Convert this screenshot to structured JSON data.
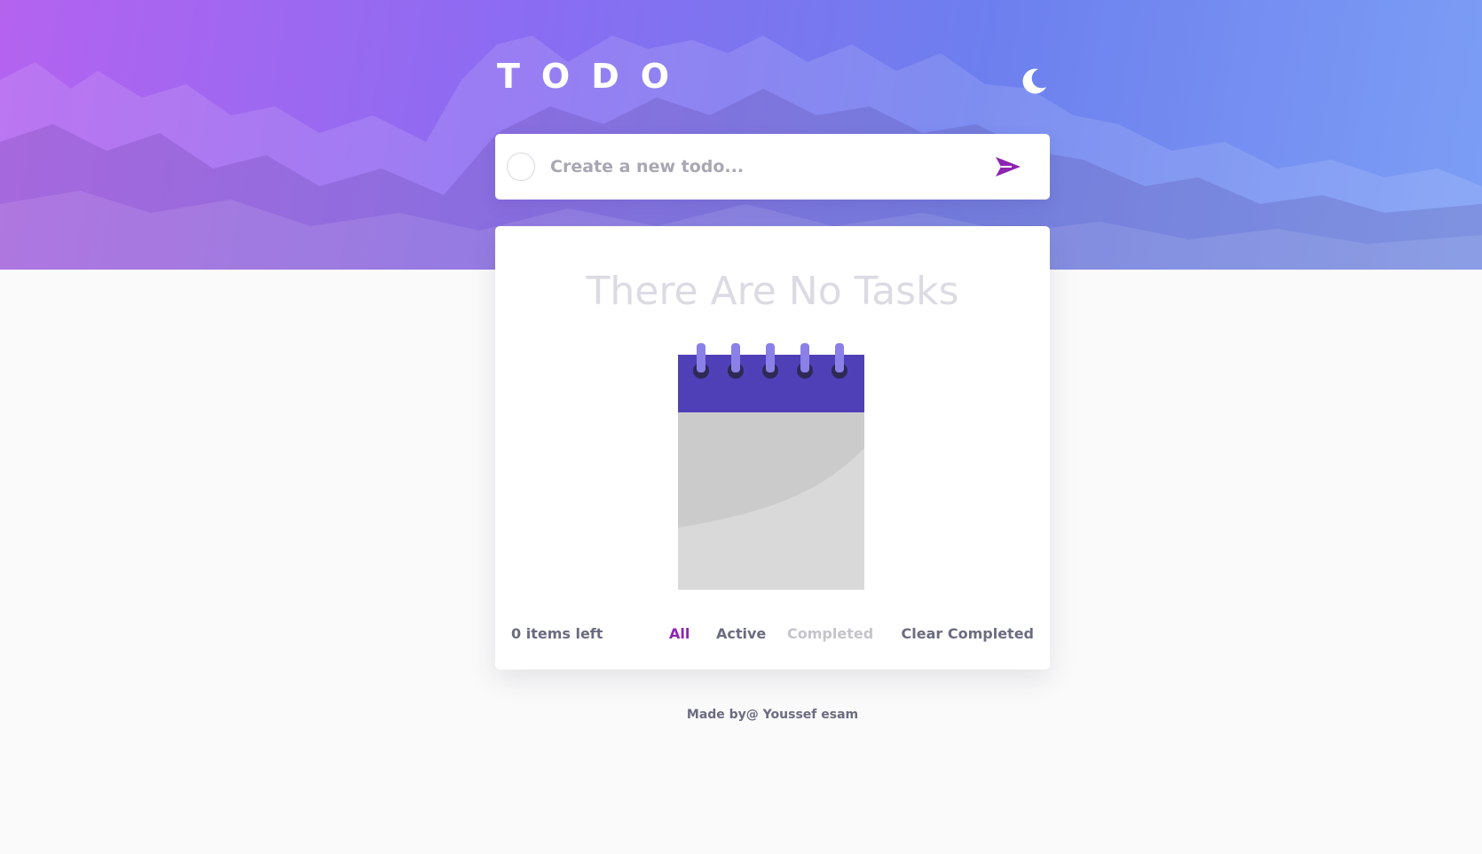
{
  "app": {
    "title": "TODO"
  },
  "header": {
    "theme_toggle_icon": "moon-icon"
  },
  "new_todo": {
    "placeholder": "Create a new todo...",
    "value": "",
    "submit_icon": "send-icon",
    "accent_color": "#8e24b2"
  },
  "list": {
    "empty_message": "There Are No Tasks",
    "illustration": "notepad-icon"
  },
  "footer": {
    "items_left": "0 items left",
    "filters": [
      {
        "label": "All",
        "selected": true
      },
      {
        "label": "Active",
        "selected": false
      },
      {
        "label": "Completed",
        "selected": false
      }
    ],
    "clear_label": "Clear Completed"
  },
  "credit": "Made by@ Youssef esam",
  "colors": {
    "header_gradient_start": "#b463ef",
    "header_gradient_end": "#7c9ef5",
    "notepad_top": "#4f40b8",
    "notepad_rings": "#8a80e8",
    "empty_text": "#dcdbe3"
  }
}
